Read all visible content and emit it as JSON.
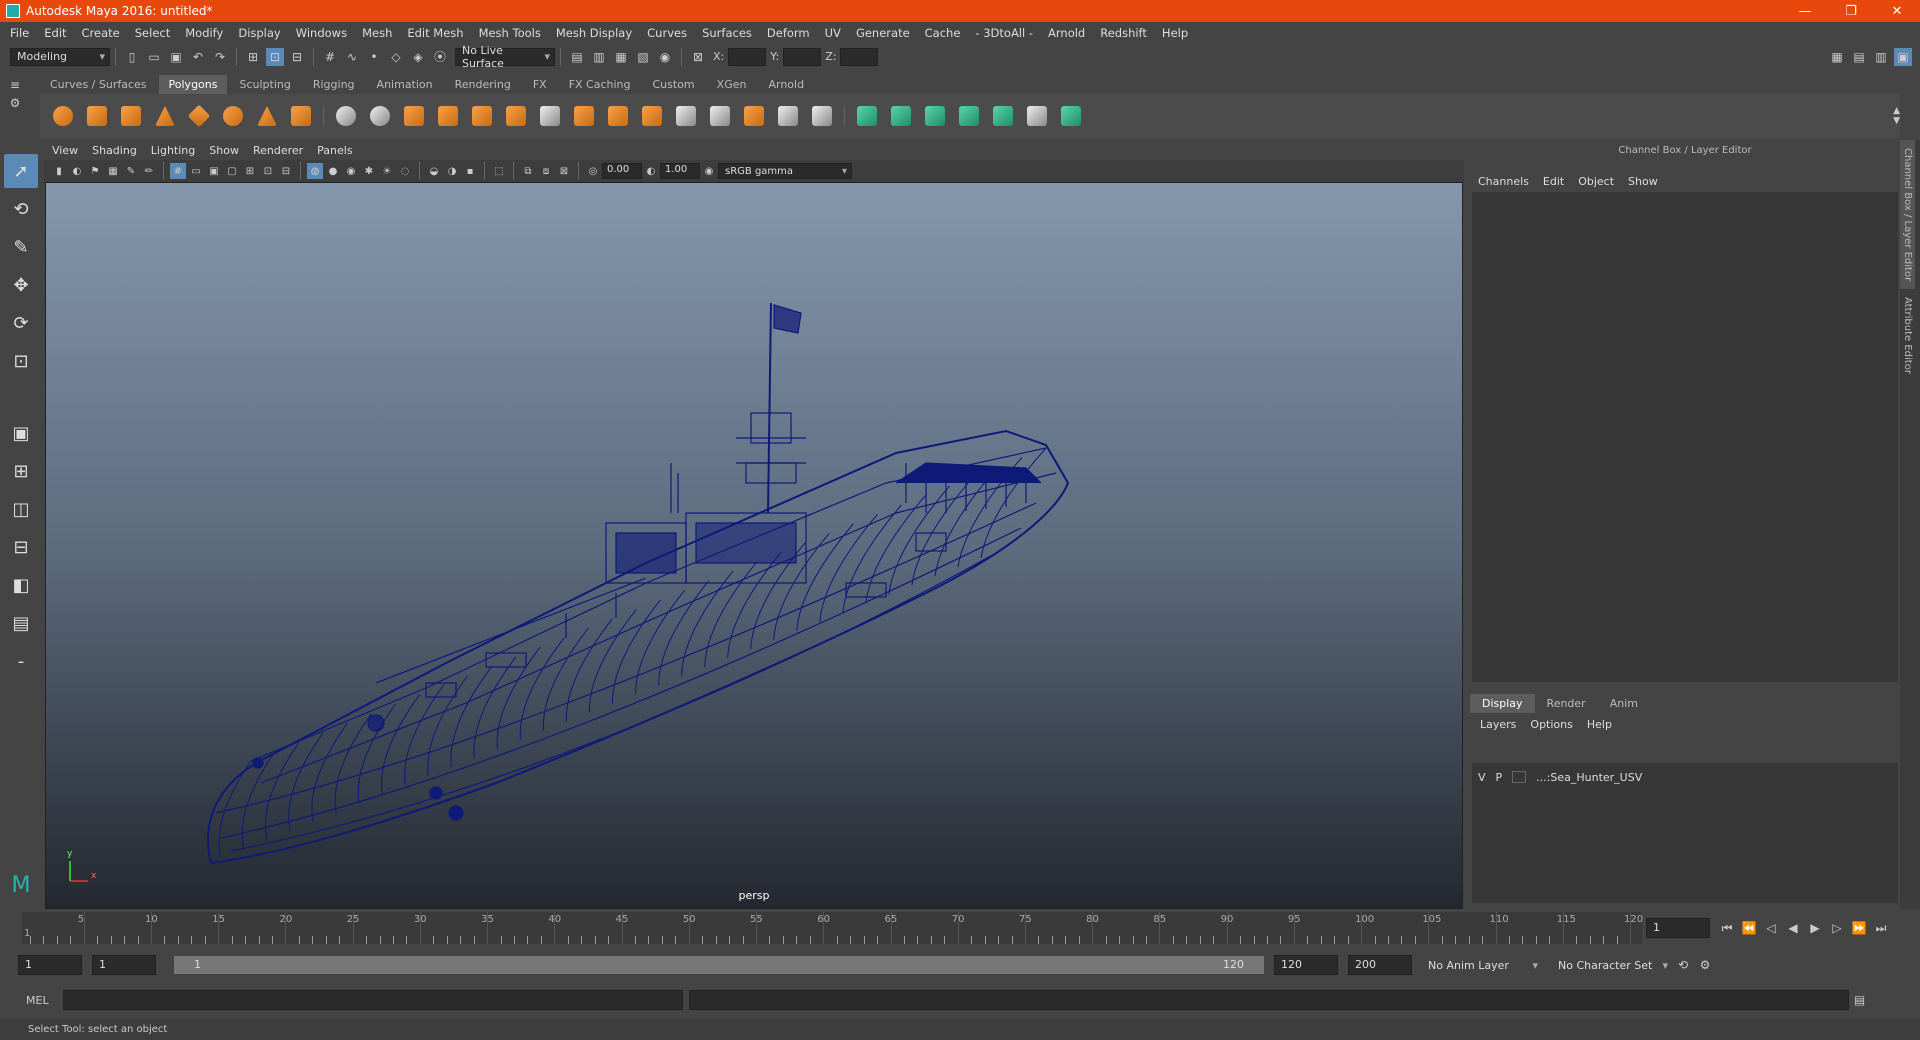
{
  "window": {
    "title": "Autodesk Maya 2016: untitled*",
    "minimize": "—",
    "restore": "❐",
    "close": "✕"
  },
  "menubar": [
    "File",
    "Edit",
    "Create",
    "Select",
    "Modify",
    "Display",
    "Windows",
    "Mesh",
    "Edit Mesh",
    "Mesh Tools",
    "Mesh Display",
    "Curves",
    "Surfaces",
    "Deform",
    "UV",
    "Generate",
    "Cache",
    "- 3DtoAll -",
    "Arnold",
    "Redshift",
    "Help"
  ],
  "statusline": {
    "mode": "Modeling",
    "live_surface": "No Live Surface",
    "x_label": "X:",
    "y_label": "Y:",
    "z_label": "Z:"
  },
  "shelf_tabs": [
    "Curves / Surfaces",
    "Polygons",
    "Sculpting",
    "Rigging",
    "Animation",
    "Rendering",
    "FX",
    "FX Caching",
    "Custom",
    "XGen",
    "Arnold"
  ],
  "shelf_active": "Polygons",
  "viewport": {
    "menu": [
      "View",
      "Shading",
      "Lighting",
      "Show",
      "Renderer",
      "Panels"
    ],
    "exposure": "0.00",
    "gamma": "1.00",
    "color_space": "sRGB gamma",
    "camera": "persp",
    "axis_x": "x",
    "axis_y": "y"
  },
  "channel_box": {
    "title": "Channel Box / Layer Editor",
    "menu": [
      "Channels",
      "Edit",
      "Object",
      "Show"
    ]
  },
  "layer_editor": {
    "tabs": [
      "Display",
      "Render",
      "Anim"
    ],
    "active_tab": "Display",
    "menu": [
      "Layers",
      "Options",
      "Help"
    ],
    "layer": {
      "v": "V",
      "p": "P",
      "name": "...:Sea_Hunter_USV"
    }
  },
  "side_tabs": [
    "Channel Box / Layer Editor",
    "Attribute Editor"
  ],
  "timeline": {
    "ticks": [
      5,
      10,
      15,
      20,
      25,
      30,
      35,
      40,
      45,
      50,
      55,
      60,
      65,
      70,
      75,
      80,
      85,
      90,
      95,
      100,
      105,
      110,
      115,
      120
    ],
    "current_frame_label": "1",
    "current_frame": "1"
  },
  "range": {
    "start": "1",
    "anim_start": "1",
    "slider_start": "1",
    "slider_end": "120",
    "end": "120",
    "anim_end": "200",
    "anim_layer": "No Anim Layer",
    "character_set": "No Character Set"
  },
  "cmdline": {
    "label": "MEL"
  },
  "helpline": {
    "text": "Select Tool: select an object"
  }
}
